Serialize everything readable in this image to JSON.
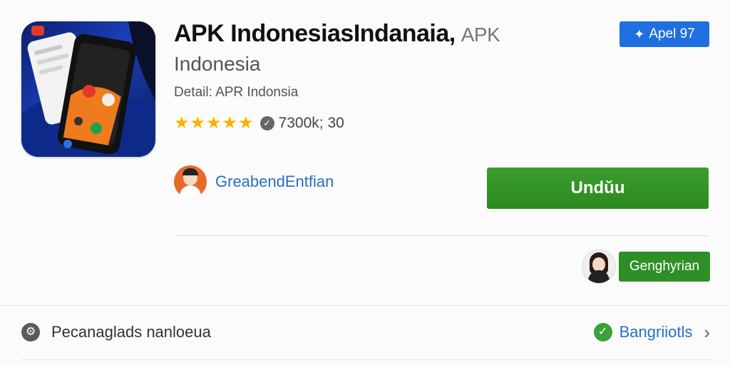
{
  "app": {
    "title": "APK IndonesiasIndanaia,",
    "title_secondary": "APK",
    "subtitle": "Indonesia",
    "detail": "Detail: APR Indonsia",
    "rating": {
      "stars": 5,
      "value_text": "7300k; 30"
    },
    "badge_text": "Apel 97",
    "icon": "app-phone-icon"
  },
  "developer": {
    "name": "GreabendEntfian",
    "avatar": "developer-avatar"
  },
  "actions": {
    "download_label": "Undŭu",
    "contact_label": "Genghyrian"
  },
  "footer": {
    "left_label": "Pecanaglads nanloeua",
    "right_link": "Bangriiotls"
  },
  "colors": {
    "accent_blue": "#1f6fe0",
    "link_blue": "#2a6fc7",
    "green": "#2e8f26",
    "star": "#f6b400"
  }
}
